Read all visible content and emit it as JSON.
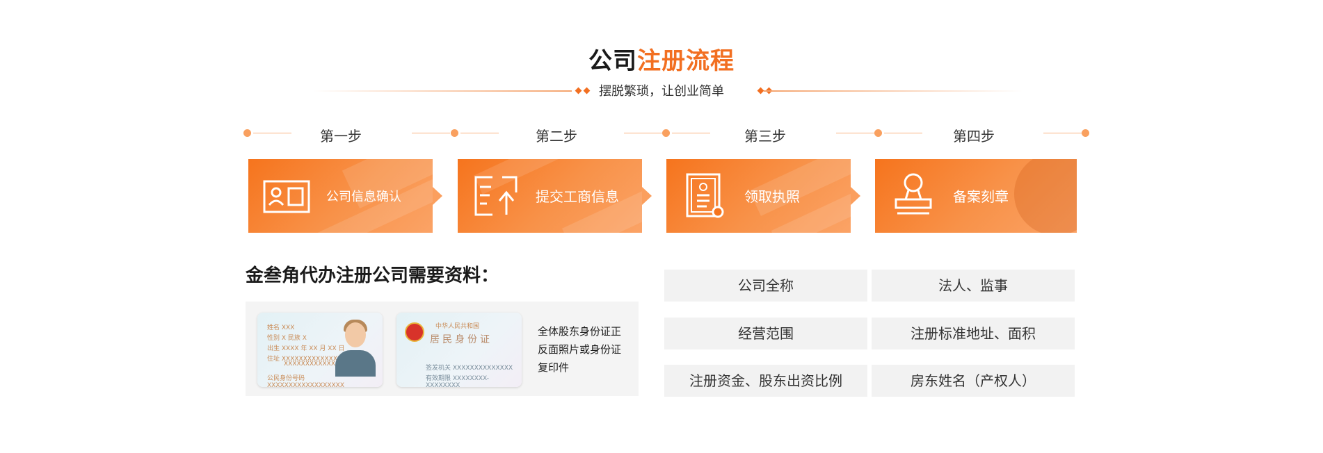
{
  "header": {
    "title_dark": "公司",
    "title_accent": "注册流程",
    "subtitle": "摆脱繁琐，让创业简单"
  },
  "steps": [
    {
      "step": "第一步",
      "card_label": "公司信息确认",
      "icon": "id-card-icon"
    },
    {
      "step": "第二步",
      "card_label": "提交工商信息",
      "icon": "document-upload-icon"
    },
    {
      "step": "第三步",
      "card_label": "领取执照",
      "icon": "license-certificate-icon"
    },
    {
      "step": "第四步",
      "card_label": "备案刻章",
      "icon": "stamp-icon"
    }
  ],
  "materials": {
    "title": "金叁角代办注册公司需要资料：",
    "id_caption_lines": [
      "全体股东身份证正",
      "反面照片或身份证",
      "复印件"
    ],
    "id_front": {
      "rows": [
        "姓名 XXX",
        "性别 X      民族 X",
        "出生  XXXX 年 XX 月 XX 日",
        "住址  XXXXXXXXXXXXXXXXX",
        "XXXXXXXXXXXXX",
        "公民身份号码        XXXXXXXXXXXXXXXXXX"
      ]
    },
    "id_back": {
      "header": "中华人民共和国",
      "title": "居民身份证",
      "rows": [
        "签发机关    XXXXXXXXXXXXXX",
        "有效期限    XXXXXXXX-XXXXXXXX"
      ]
    },
    "requirements": [
      "公司全称",
      "法人、监事",
      "经营范围",
      "注册标准地址、面积",
      "注册资金、股东出资比例",
      "房东姓名（产权人）"
    ]
  },
  "colors": {
    "accent": "#f26f21",
    "card_gradient_start": "#f6741d",
    "panel_bg": "#f4f4f4",
    "req_bg": "#f2f2f2"
  }
}
